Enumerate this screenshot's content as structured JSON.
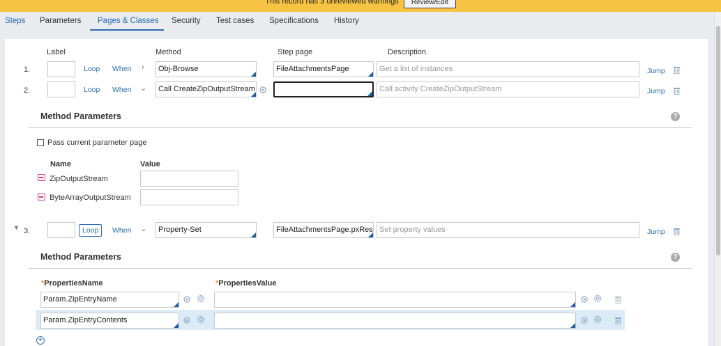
{
  "warning": {
    "text": "This record has 3 unreviewed warnings",
    "button": "Review/Edit"
  },
  "tabs": [
    "Steps",
    "Parameters",
    "Pages & Classes",
    "Security",
    "Test cases",
    "Specifications",
    "History"
  ],
  "columns": {
    "label": "Label",
    "method": "Method",
    "step_page": "Step page",
    "description": "Description"
  },
  "steps": [
    {
      "num": "1.",
      "loop": "Loop",
      "when": "When",
      "method": "Obj-Browse",
      "step_page": "FileAttachmentsPage",
      "description": "Get a list of instances",
      "jump": "Jump"
    },
    {
      "num": "2.",
      "loop": "Loop",
      "when": "When",
      "method": "Call CreateZipOutputStream",
      "step_page": "",
      "description": "Call activity CreateZipOutputStream",
      "jump": "Jump"
    },
    {
      "num": "3.",
      "loop": "Loop",
      "when": "When",
      "method": "Property-Set",
      "step_page": "FileAttachmentsPage.pxResults",
      "description": "Set property values",
      "jump": "Jump"
    }
  ],
  "step2_params": {
    "title": "Method Parameters",
    "pass_current": "Pass current parameter page",
    "name_header": "Name",
    "value_header": "Value",
    "rows": [
      {
        "name": "ZipOutputStream",
        "value": ""
      },
      {
        "name": "ByteArrayOutputStream",
        "value": ""
      }
    ]
  },
  "step3_params": {
    "title": "Method Parameters",
    "prop_name_header": "PropertiesName",
    "prop_value_header": "PropertiesValue",
    "required_marker": "*",
    "rows": [
      {
        "name": "Param.ZipEntryName",
        "value": ""
      },
      {
        "name": "Param.ZipEntryContents",
        "value": ""
      }
    ]
  },
  "colors": {
    "warning_bg": "#f6c343",
    "accent": "#2b6cb0",
    "highlight_row": "#dcecf7"
  },
  "icons": [
    "trash-icon",
    "help-icon",
    "gear-icon",
    "target-icon",
    "add-icon",
    "page-icon",
    "chevron-right-icon",
    "chevron-down-icon"
  ]
}
